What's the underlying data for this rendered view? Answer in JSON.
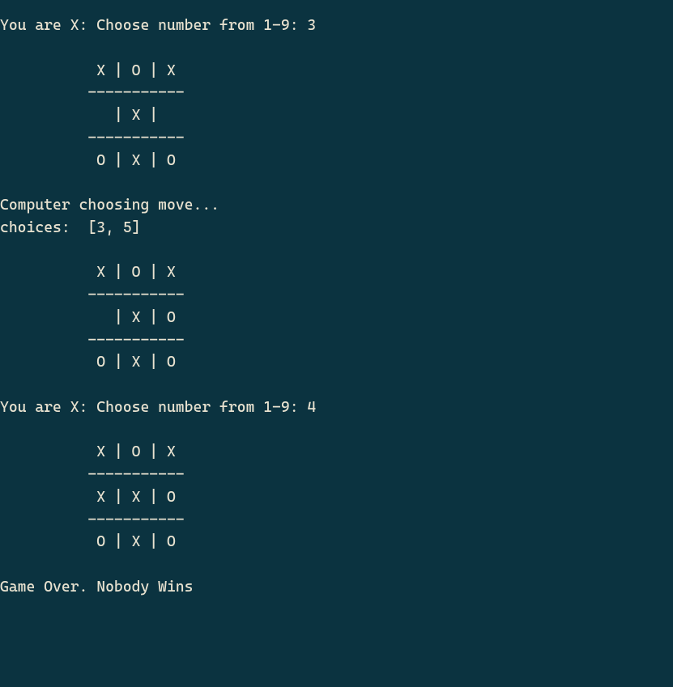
{
  "turns": [
    {
      "prompt_prefix": "You are X: Choose number from 1-9: ",
      "player_input": "3",
      "board": {
        "rows": [
          [
            " X ",
            " O ",
            " X "
          ],
          [
            "   ",
            " X ",
            "   "
          ],
          [
            " O ",
            " X ",
            " O "
          ]
        ]
      }
    },
    {
      "computer_line": "Computer choosing move...",
      "choices_label": "choices:  ",
      "choices_value": "[3, 5]",
      "board": {
        "rows": [
          [
            " X ",
            " O ",
            " X "
          ],
          [
            "   ",
            " X ",
            " O "
          ],
          [
            " O ",
            " X ",
            " O "
          ]
        ]
      }
    },
    {
      "prompt_prefix": "You are X: Choose number from 1-9: ",
      "player_input": "4",
      "board": {
        "rows": [
          [
            " X ",
            " O ",
            " X "
          ],
          [
            " X ",
            " X ",
            " O "
          ],
          [
            " O ",
            " X ",
            " O "
          ]
        ]
      }
    }
  ],
  "board_render": {
    "indent": "          ",
    "cell_sep": "|",
    "row_sep": "-----------"
  },
  "game_over": "Game Over. Nobody Wins"
}
